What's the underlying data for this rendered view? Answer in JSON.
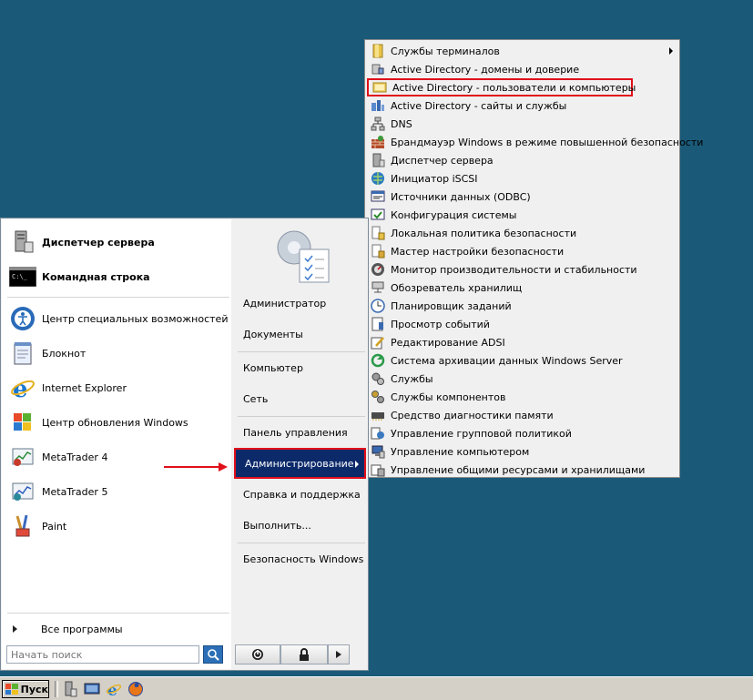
{
  "start_menu": {
    "pinned": [
      {
        "label": "Диспетчер сервера",
        "icon": "server-manager-icon",
        "bold": true
      },
      {
        "label": "Командная строка",
        "icon": "command-prompt-icon",
        "bold": true
      }
    ],
    "recent": [
      {
        "label": "Центр специальных возможностей",
        "icon": "accessibility-icon"
      },
      {
        "label": "Блокнот",
        "icon": "notepad-icon"
      },
      {
        "label": "Internet Explorer",
        "icon": "internet-explorer-icon"
      },
      {
        "label": "Центр обновления Windows",
        "icon": "windows-update-icon"
      },
      {
        "label": "MetaTrader 4",
        "icon": "metatrader4-icon"
      },
      {
        "label": "MetaTrader 5",
        "icon": "metatrader5-icon"
      },
      {
        "label": "Paint",
        "icon": "paint-icon"
      }
    ],
    "all_programs": "Все программы",
    "search_placeholder": "Начать поиск",
    "right": {
      "user": "Администратор",
      "documents": "Документы",
      "computer": "Компьютер",
      "network": "Сеть",
      "control_panel": "Панель управления",
      "admin_tools": "Администрирование",
      "help": "Справка и поддержка",
      "run": "Выполнить...",
      "security": "Безопасность Windows"
    }
  },
  "admin_menu": {
    "items": [
      {
        "label": "Службы терминалов",
        "icon": "folder-icon"
      },
      {
        "label": "Active Directory - домены и доверие",
        "icon": "ad-domains-icon"
      },
      {
        "label": "Active Directory - пользователи и компьютеры",
        "icon": "ad-users-icon"
      },
      {
        "label": "Active Directory - сайты и службы",
        "icon": "ad-sites-icon"
      },
      {
        "label": "DNS",
        "icon": "dns-icon"
      },
      {
        "label": "Брандмауэр Windows в режиме повышенной безопасности",
        "icon": "firewall-icon"
      },
      {
        "label": "Диспетчер сервера",
        "icon": "server-manager-icon"
      },
      {
        "label": "Инициатор iSCSI",
        "icon": "iscsi-icon"
      },
      {
        "label": "Источники данных (ODBC)",
        "icon": "odbc-icon"
      },
      {
        "label": "Конфигурация системы",
        "icon": "msconfig-icon"
      },
      {
        "label": "Локальная политика безопасности",
        "icon": "local-policy-icon"
      },
      {
        "label": "Мастер настройки безопасности",
        "icon": "security-wizard-icon"
      },
      {
        "label": "Монитор производительности и стабильности",
        "icon": "perfmon-icon"
      },
      {
        "label": "Обозреватель хранилищ",
        "icon": "storage-explorer-icon"
      },
      {
        "label": "Планировщик заданий",
        "icon": "task-scheduler-icon"
      },
      {
        "label": "Просмотр событий",
        "icon": "event-viewer-icon"
      },
      {
        "label": "Редактирование ADSI",
        "icon": "adsi-edit-icon"
      },
      {
        "label": "Система архивации данных Windows Server",
        "icon": "backup-icon"
      },
      {
        "label": "Службы",
        "icon": "services-icon"
      },
      {
        "label": "Службы компонентов",
        "icon": "component-services-icon"
      },
      {
        "label": "Средство диагностики памяти",
        "icon": "memory-diagnostic-icon"
      },
      {
        "label": "Управление групповой политикой",
        "icon": "gpmc-icon"
      },
      {
        "label": "Управление компьютером",
        "icon": "computer-management-icon"
      },
      {
        "label": "Управление общими ресурсами и хранилищами",
        "icon": "share-storage-icon"
      }
    ]
  },
  "taskbar": {
    "start_label": "Пуск"
  },
  "colors": {
    "desktop": "#1a5a78",
    "highlight": "#0c2a6a",
    "annotation_red": "#e0101a"
  }
}
